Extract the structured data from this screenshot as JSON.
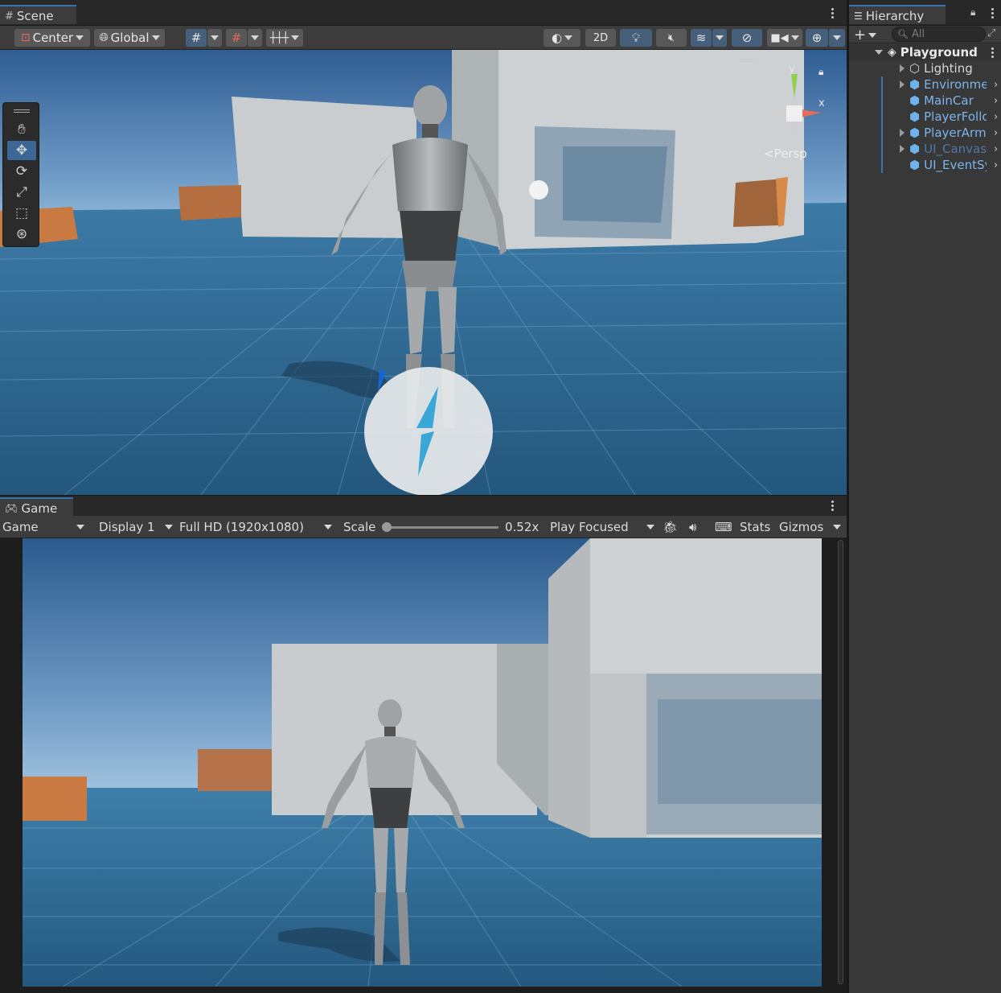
{
  "scene": {
    "tab_label": "Scene",
    "pivot_label": "Center",
    "space_label": "Global",
    "mode_2d_label": "2D",
    "projection_label": "Persp",
    "gizmo_axes": {
      "y": "y",
      "x": "x"
    },
    "tools": [
      "hand-tool",
      "move-tool",
      "rotate-tool",
      "scale-tool",
      "rect-tool",
      "transform-tool"
    ],
    "active_tool": "move-tool"
  },
  "game": {
    "tab_label": "Game",
    "view_label": "Game",
    "display_label": "Display 1",
    "resolution_label": "Full HD (1920x1080)",
    "scale_label": "Scale",
    "scale_value": "0.52x",
    "scale_fraction": 0.0,
    "play_mode_label": "Play Focused",
    "stats_label": "Stats",
    "gizmos_label": "Gizmos"
  },
  "hierarchy": {
    "tab_label": "Hierarchy",
    "search_placeholder": "All",
    "root": "Playground",
    "items": [
      {
        "label": "Lighting",
        "expandable": true,
        "color": "#d7d7d7"
      },
      {
        "label": "Environme",
        "expandable": true,
        "color": "#7cb5ec"
      },
      {
        "label": "MainCar",
        "expandable": false,
        "color": "#7cb5ec"
      },
      {
        "label": "PlayerFollo",
        "expandable": false,
        "color": "#7cb5ec"
      },
      {
        "label": "PlayerArma",
        "expandable": true,
        "color": "#7cb5ec"
      },
      {
        "label": "UI_Canvas_",
        "expandable": true,
        "color": "#4f79a4"
      },
      {
        "label": "UI_EventSy",
        "expandable": false,
        "color": "#7cb5ec"
      }
    ]
  },
  "colors": {
    "accent": "#3a72b0",
    "sky": "#5585b8",
    "floor": "#2f6995",
    "wall": "#c9cdcf",
    "crate": "#c97a42"
  }
}
